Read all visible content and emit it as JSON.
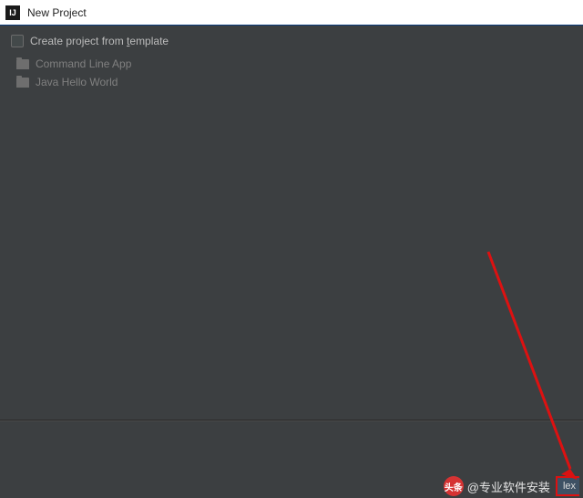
{
  "window": {
    "title": "New Project",
    "app_icon_letter": "IJ"
  },
  "checkbox": {
    "label_pre": "Create project from ",
    "label_underline": "t",
    "label_post": "emplate",
    "checked": false
  },
  "templates": [
    {
      "label": "Command Line App"
    },
    {
      "label": "Java Hello World"
    }
  ],
  "watermark": {
    "badge": "头条",
    "text": "@专业软件安装"
  },
  "button_fragment": {
    "label": "lex"
  },
  "annotation": {
    "arrow_color": "#d11"
  }
}
